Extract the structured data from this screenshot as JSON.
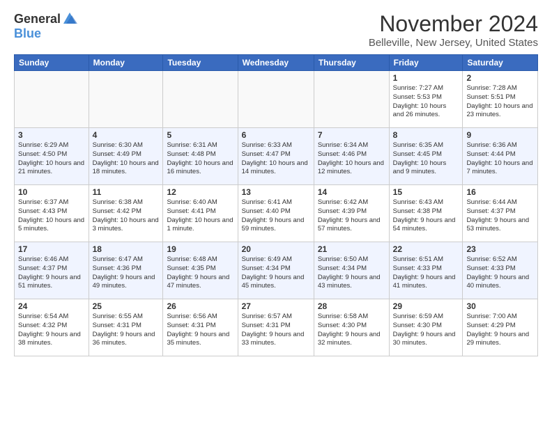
{
  "logo": {
    "general": "General",
    "blue": "Blue"
  },
  "header": {
    "month": "November 2024",
    "location": "Belleville, New Jersey, United States"
  },
  "weekdays": [
    "Sunday",
    "Monday",
    "Tuesday",
    "Wednesday",
    "Thursday",
    "Friday",
    "Saturday"
  ],
  "weeks": [
    [
      {
        "day": "",
        "info": ""
      },
      {
        "day": "",
        "info": ""
      },
      {
        "day": "",
        "info": ""
      },
      {
        "day": "",
        "info": ""
      },
      {
        "day": "",
        "info": ""
      },
      {
        "day": "1",
        "info": "Sunrise: 7:27 AM\nSunset: 5:53 PM\nDaylight: 10 hours and 26 minutes."
      },
      {
        "day": "2",
        "info": "Sunrise: 7:28 AM\nSunset: 5:51 PM\nDaylight: 10 hours and 23 minutes."
      }
    ],
    [
      {
        "day": "3",
        "info": "Sunrise: 6:29 AM\nSunset: 4:50 PM\nDaylight: 10 hours and 21 minutes."
      },
      {
        "day": "4",
        "info": "Sunrise: 6:30 AM\nSunset: 4:49 PM\nDaylight: 10 hours and 18 minutes."
      },
      {
        "day": "5",
        "info": "Sunrise: 6:31 AM\nSunset: 4:48 PM\nDaylight: 10 hours and 16 minutes."
      },
      {
        "day": "6",
        "info": "Sunrise: 6:33 AM\nSunset: 4:47 PM\nDaylight: 10 hours and 14 minutes."
      },
      {
        "day": "7",
        "info": "Sunrise: 6:34 AM\nSunset: 4:46 PM\nDaylight: 10 hours and 12 minutes."
      },
      {
        "day": "8",
        "info": "Sunrise: 6:35 AM\nSunset: 4:45 PM\nDaylight: 10 hours and 9 minutes."
      },
      {
        "day": "9",
        "info": "Sunrise: 6:36 AM\nSunset: 4:44 PM\nDaylight: 10 hours and 7 minutes."
      }
    ],
    [
      {
        "day": "10",
        "info": "Sunrise: 6:37 AM\nSunset: 4:43 PM\nDaylight: 10 hours and 5 minutes."
      },
      {
        "day": "11",
        "info": "Sunrise: 6:38 AM\nSunset: 4:42 PM\nDaylight: 10 hours and 3 minutes."
      },
      {
        "day": "12",
        "info": "Sunrise: 6:40 AM\nSunset: 4:41 PM\nDaylight: 10 hours and 1 minute."
      },
      {
        "day": "13",
        "info": "Sunrise: 6:41 AM\nSunset: 4:40 PM\nDaylight: 9 hours and 59 minutes."
      },
      {
        "day": "14",
        "info": "Sunrise: 6:42 AM\nSunset: 4:39 PM\nDaylight: 9 hours and 57 minutes."
      },
      {
        "day": "15",
        "info": "Sunrise: 6:43 AM\nSunset: 4:38 PM\nDaylight: 9 hours and 54 minutes."
      },
      {
        "day": "16",
        "info": "Sunrise: 6:44 AM\nSunset: 4:37 PM\nDaylight: 9 hours and 53 minutes."
      }
    ],
    [
      {
        "day": "17",
        "info": "Sunrise: 6:46 AM\nSunset: 4:37 PM\nDaylight: 9 hours and 51 minutes."
      },
      {
        "day": "18",
        "info": "Sunrise: 6:47 AM\nSunset: 4:36 PM\nDaylight: 9 hours and 49 minutes."
      },
      {
        "day": "19",
        "info": "Sunrise: 6:48 AM\nSunset: 4:35 PM\nDaylight: 9 hours and 47 minutes."
      },
      {
        "day": "20",
        "info": "Sunrise: 6:49 AM\nSunset: 4:34 PM\nDaylight: 9 hours and 45 minutes."
      },
      {
        "day": "21",
        "info": "Sunrise: 6:50 AM\nSunset: 4:34 PM\nDaylight: 9 hours and 43 minutes."
      },
      {
        "day": "22",
        "info": "Sunrise: 6:51 AM\nSunset: 4:33 PM\nDaylight: 9 hours and 41 minutes."
      },
      {
        "day": "23",
        "info": "Sunrise: 6:52 AM\nSunset: 4:33 PM\nDaylight: 9 hours and 40 minutes."
      }
    ],
    [
      {
        "day": "24",
        "info": "Sunrise: 6:54 AM\nSunset: 4:32 PM\nDaylight: 9 hours and 38 minutes."
      },
      {
        "day": "25",
        "info": "Sunrise: 6:55 AM\nSunset: 4:31 PM\nDaylight: 9 hours and 36 minutes."
      },
      {
        "day": "26",
        "info": "Sunrise: 6:56 AM\nSunset: 4:31 PM\nDaylight: 9 hours and 35 minutes."
      },
      {
        "day": "27",
        "info": "Sunrise: 6:57 AM\nSunset: 4:31 PM\nDaylight: 9 hours and 33 minutes."
      },
      {
        "day": "28",
        "info": "Sunrise: 6:58 AM\nSunset: 4:30 PM\nDaylight: 9 hours and 32 minutes."
      },
      {
        "day": "29",
        "info": "Sunrise: 6:59 AM\nSunset: 4:30 PM\nDaylight: 9 hours and 30 minutes."
      },
      {
        "day": "30",
        "info": "Sunrise: 7:00 AM\nSunset: 4:29 PM\nDaylight: 9 hours and 29 minutes."
      }
    ]
  ]
}
